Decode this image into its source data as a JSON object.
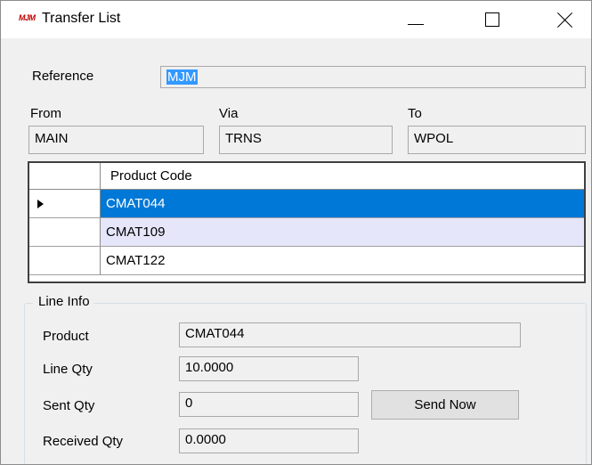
{
  "window": {
    "app_icon_text": "MJM",
    "title": "Transfer List"
  },
  "reference": {
    "label": "Reference",
    "value": "MJM"
  },
  "from": {
    "label": "From",
    "value": "MAIN"
  },
  "via": {
    "label": "Via",
    "value": "TRNS"
  },
  "to": {
    "label": "To",
    "value": "WPOL"
  },
  "grid": {
    "column_header": "Product Code",
    "rows": [
      {
        "product_code": "CMAT044",
        "current": true,
        "selected": true
      },
      {
        "product_code": "CMAT109",
        "current": false,
        "selected": false
      },
      {
        "product_code": "CMAT122",
        "current": false,
        "selected": false
      }
    ]
  },
  "line_info": {
    "title": "Line Info",
    "product_label": "Product",
    "product_value": "CMAT044",
    "line_qty_label": "Line Qty",
    "line_qty_value": "10.0000",
    "sent_qty_label": "Sent Qty",
    "sent_qty_value": "0",
    "send_now_label": "Send Now",
    "received_qty_label": "Received Qty",
    "received_qty_value": "0.0000"
  },
  "colors": {
    "selection": "#0078d7",
    "alt_row": "#e6e6fa",
    "text_selection": "#3399ff"
  }
}
